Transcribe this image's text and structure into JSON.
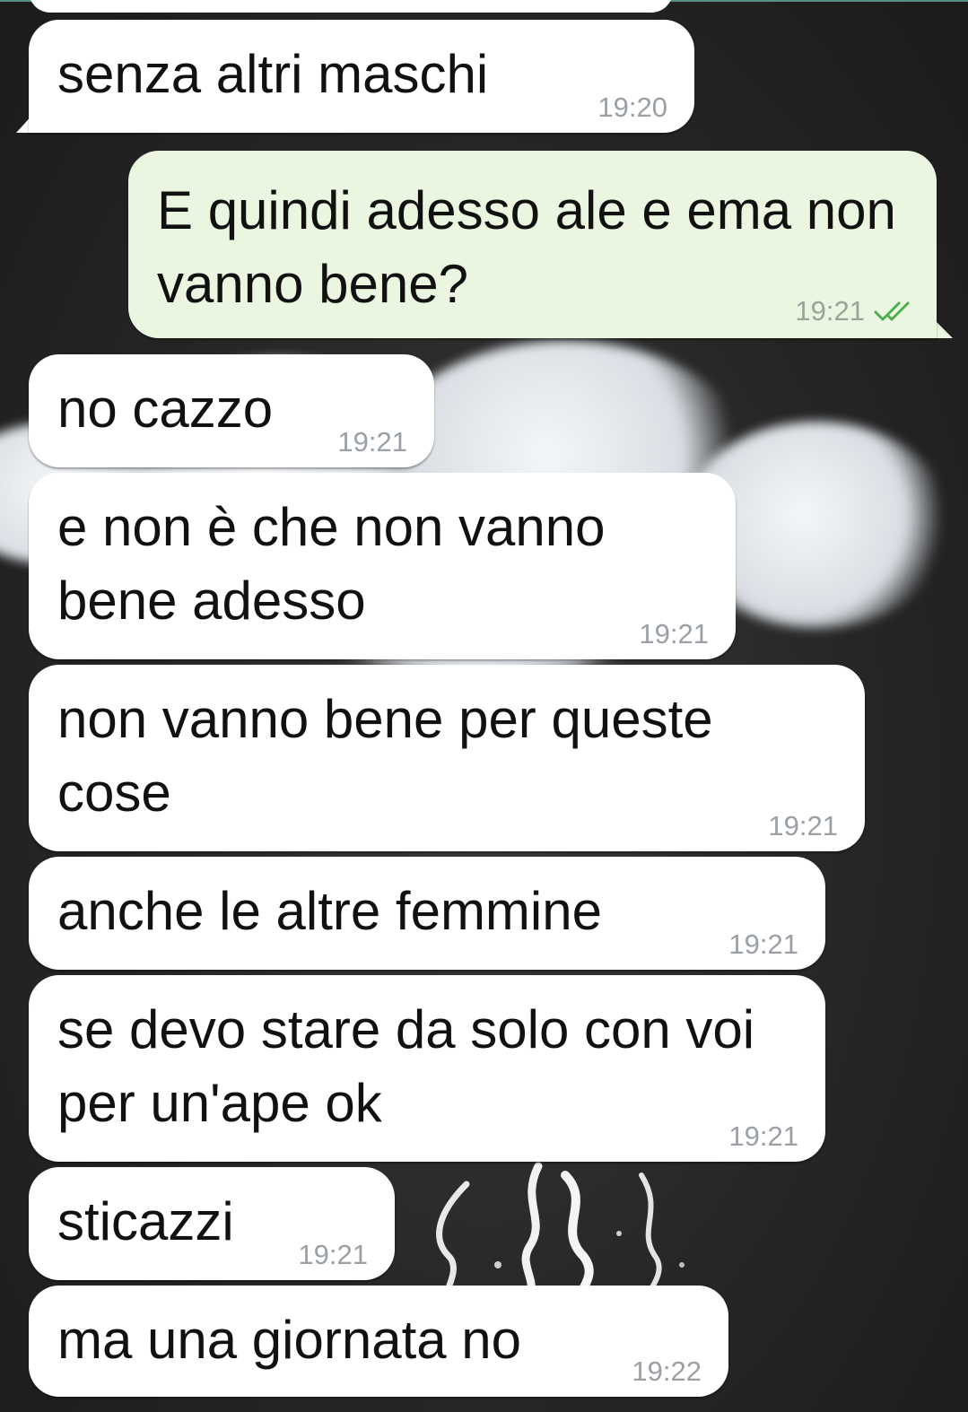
{
  "messages": [
    {
      "id": "m1",
      "direction": "incoming",
      "text": "senza altri maschi",
      "time": "19:20"
    },
    {
      "id": "m2",
      "direction": "outgoing",
      "text": "E quindi adesso ale e ema non vanno bene?",
      "time": "19:21",
      "status": "read",
      "status_icon": "double-check-icon",
      "status_color": "#4fae4e"
    },
    {
      "id": "m3",
      "direction": "incoming",
      "text": "no cazzo",
      "time": "19:21"
    },
    {
      "id": "m4",
      "direction": "incoming",
      "text": "e non è che non vanno bene adesso",
      "time": "19:21"
    },
    {
      "id": "m5",
      "direction": "incoming",
      "text": "non vanno bene per queste cose",
      "time": "19:21"
    },
    {
      "id": "m6",
      "direction": "incoming",
      "text": "anche le altre femmine",
      "time": "19:21"
    },
    {
      "id": "m7",
      "direction": "incoming",
      "text": "se devo stare da solo con voi per un'ape ok",
      "time": "19:21"
    },
    {
      "id": "m8",
      "direction": "incoming",
      "text": "sticazzi",
      "time": "19:21"
    },
    {
      "id": "m9",
      "direction": "incoming",
      "text": "ma una giornata no",
      "time": "19:22"
    }
  ],
  "colors": {
    "incoming_bubble": "#ffffff",
    "outgoing_bubble": "#eaf6df",
    "timestamp": "#9aa0a6",
    "read_ticks": "#4fae4e",
    "wallpaper": "#262626"
  }
}
